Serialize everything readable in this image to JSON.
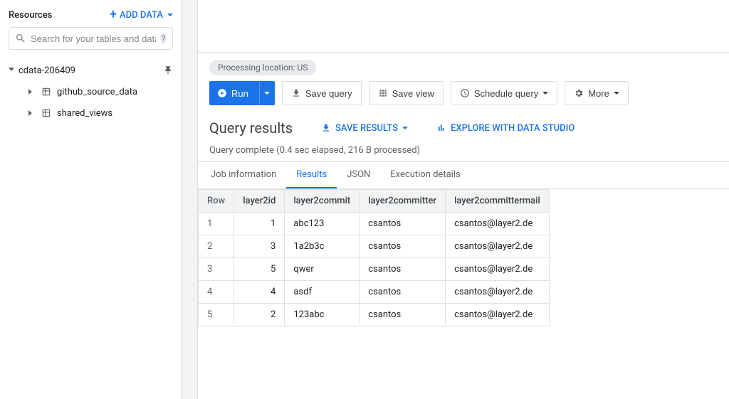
{
  "sidebar": {
    "title": "Resources",
    "add_data_label": "ADD DATA",
    "search_placeholder": "Search for your tables and datas...",
    "project": "cdata-206409",
    "datasets": [
      "github_source_data",
      "shared_views"
    ]
  },
  "processing_location": "Processing location: US",
  "toolbar": {
    "run": "Run",
    "save_query": "Save query",
    "save_view": "Save view",
    "schedule": "Schedule query",
    "more": "More"
  },
  "results": {
    "title": "Query results",
    "save_results": "SAVE RESULTS",
    "explore": "EXPLORE WITH DATA STUDIO",
    "status": "Query complete (0.4 sec elapsed, 216 B processed)"
  },
  "tabs": [
    "Job information",
    "Results",
    "JSON",
    "Execution details"
  ],
  "active_tab": 1,
  "table": {
    "columns": [
      "Row",
      "layer2id",
      "layer2commit",
      "layer2committer",
      "layer2committermail"
    ],
    "rows": [
      [
        "1",
        "1",
        "abc123",
        "csantos",
        "csantos@layer2.de"
      ],
      [
        "2",
        "3",
        "1a2b3c",
        "csantos",
        "csantos@layer2.de"
      ],
      [
        "3",
        "5",
        "qwer",
        "csantos",
        "csantos@layer2.de"
      ],
      [
        "4",
        "4",
        "asdf",
        "csantos",
        "csantos@layer2.de"
      ],
      [
        "5",
        "2",
        "123abc",
        "csantos",
        "csantos@layer2.de"
      ]
    ]
  }
}
